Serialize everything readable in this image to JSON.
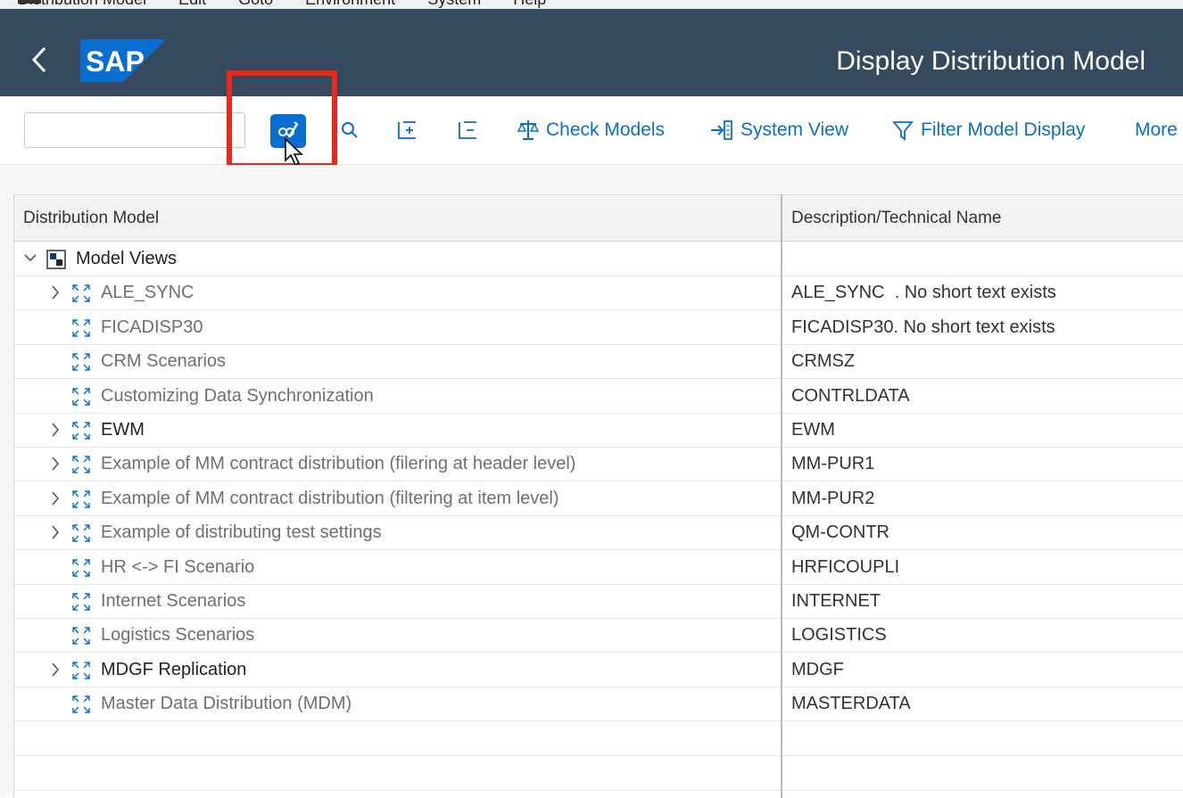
{
  "menu": {
    "items": [
      "Distribution Model",
      "Edit",
      "Goto",
      "Environment",
      "System",
      "Help"
    ]
  },
  "shell": {
    "back_icon": "chevron-left-icon",
    "logo_text": "SAP",
    "title": "Display Distribution Model",
    "colors": {
      "header_bg": "#354a5f",
      "logo_blue": "#0a6ed1"
    }
  },
  "toolbar": {
    "combo_value": "",
    "check_models": "Check Models",
    "system_view": "System View",
    "filter_model_display": "Filter Model Display",
    "more": "More",
    "accent": "#0a6ed1"
  },
  "tree": {
    "col1": "Distribution Model",
    "col2": "Description/Technical Name",
    "root": {
      "label": "Model Views",
      "expanded": true
    },
    "rows": [
      {
        "label": "ALE_SYNC",
        "desc": "ALE_SYNC  . No short text exists",
        "expandable": true,
        "style": "gray"
      },
      {
        "label": "FICADISP30",
        "desc": "FICADISP30. No short text exists",
        "expandable": false,
        "style": "gray"
      },
      {
        "label": "CRM Scenarios",
        "desc": "CRMSZ",
        "expandable": false,
        "style": "gray"
      },
      {
        "label": "Customizing Data Synchronization",
        "desc": "CONTRLDATA",
        "expandable": false,
        "style": "gray"
      },
      {
        "label": "EWM",
        "desc": "EWM",
        "expandable": true,
        "style": "dark"
      },
      {
        "label": "Example of MM contract distribution (filering at header level)",
        "desc": "MM-PUR1",
        "expandable": true,
        "style": "gray"
      },
      {
        "label": "Example of MM contract distribution (filtering at item level)",
        "desc": "MM-PUR2",
        "expandable": true,
        "style": "gray"
      },
      {
        "label": "Example of distributing test settings",
        "desc": "QM-CONTR",
        "expandable": true,
        "style": "gray"
      },
      {
        "label": "HR <-> FI Scenario",
        "desc": "HRFICOUPLI",
        "expandable": false,
        "style": "gray"
      },
      {
        "label": "Internet Scenarios",
        "desc": "INTERNET",
        "expandable": false,
        "style": "gray"
      },
      {
        "label": "Logistics Scenarios",
        "desc": "LOGISTICS",
        "expandable": false,
        "style": "gray"
      },
      {
        "label": "MDGF Replication",
        "desc": "MDGF",
        "expandable": true,
        "style": "dark"
      },
      {
        "label": "Master Data Distribution (MDM)",
        "desc": "MASTERDATA",
        "expandable": false,
        "style": "gray"
      }
    ]
  }
}
